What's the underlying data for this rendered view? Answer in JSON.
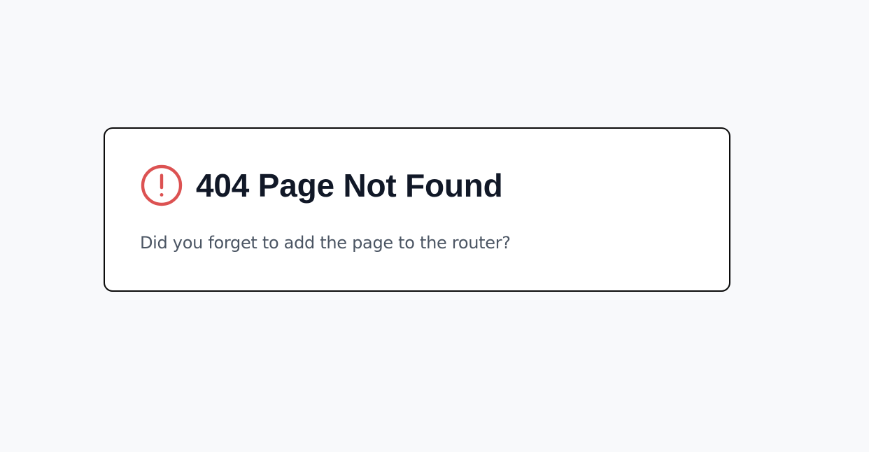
{
  "page": {
    "background": "#f8f9fb"
  },
  "error_card": {
    "icon": "alert-circle-icon",
    "icon_color": "#dc5252",
    "title": "404 Page Not Found",
    "title_color": "#111827",
    "message": "Did you forget to add the page to the router?",
    "message_color": "#4b5563"
  }
}
